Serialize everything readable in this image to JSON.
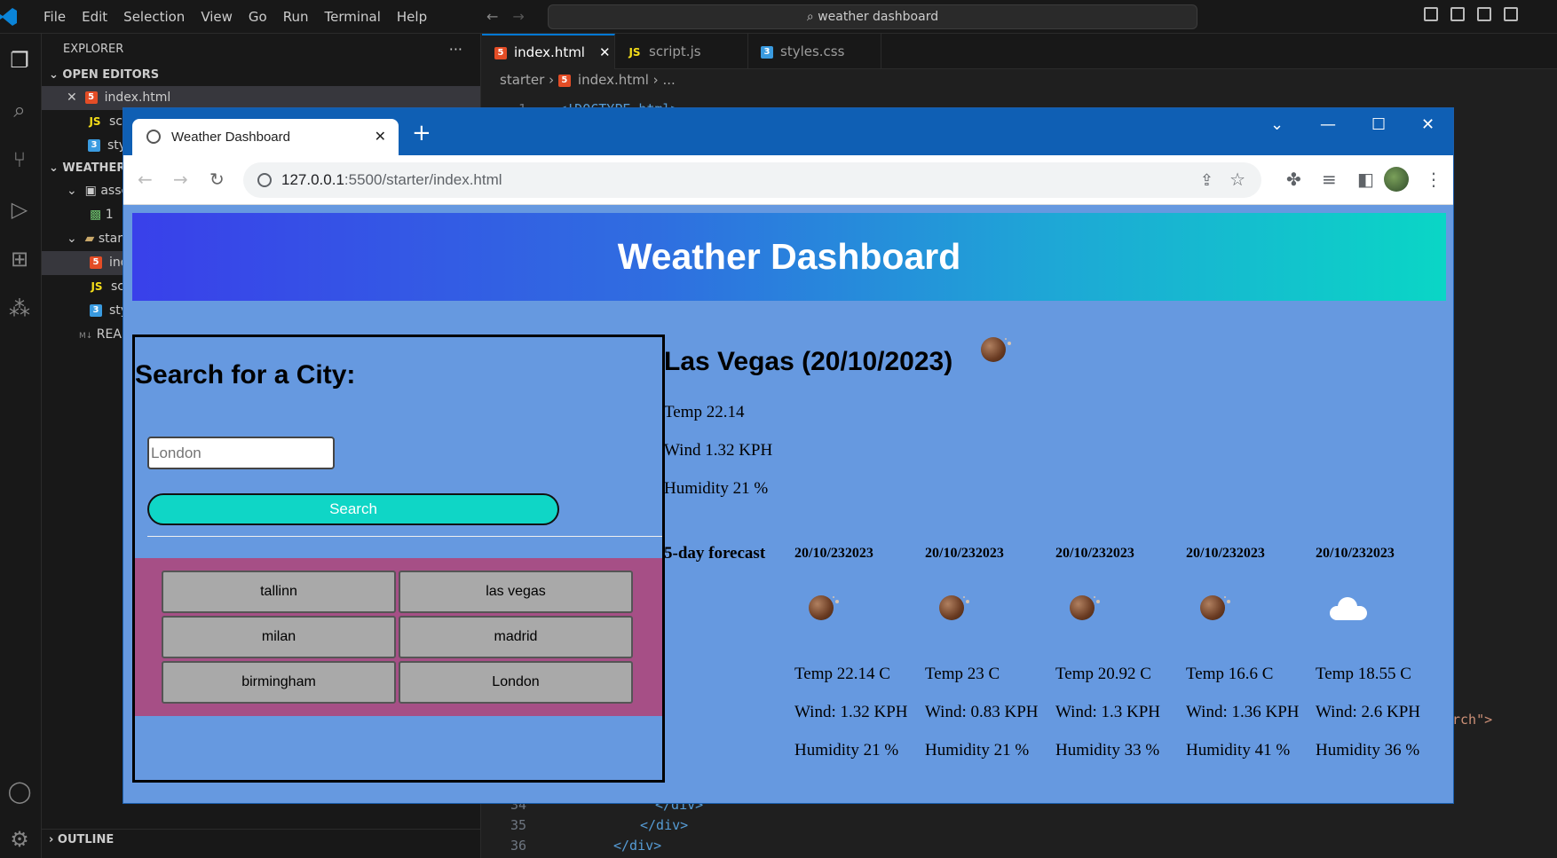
{
  "vscode": {
    "menu": [
      "File",
      "Edit",
      "Selection",
      "View",
      "Go",
      "Run",
      "Terminal",
      "Help"
    ],
    "command_search": "weather dashboard",
    "sidebar": {
      "title": "EXPLORER",
      "open_editors_label": "OPEN EDITORS",
      "project_label": "WEATHER",
      "readme_label": "REA",
      "outline_label": "OUTLINE",
      "open_editor_items": [
        "index.html",
        "script.js",
        "styles.css"
      ],
      "tree_items": [
        "assets",
        "1",
        "starter",
        "index.html",
        "script.js",
        "styles.css"
      ]
    },
    "tabs": [
      {
        "label": "index.html",
        "icon": "html5-icon",
        "active": true
      },
      {
        "label": "script.js",
        "icon": "js-icon",
        "active": false
      },
      {
        "label": "styles.css",
        "icon": "css3-icon",
        "active": false
      }
    ],
    "breadcrumb": {
      "folder": "starter",
      "file": "index.html",
      "rest": "..."
    },
    "code": {
      "line1_num": "1",
      "line1_text": "<!DOCTYPE html>",
      "right_fragment": "rch\">",
      "line34_num": "34",
      "line34_text": "</div>",
      "line35_num": "35",
      "line35_text": "</div>",
      "line36_num": "36",
      "line36_text": "</div>"
    }
  },
  "browser": {
    "tab_title": "Weather Dashboard",
    "url_host": "127.0.0.1",
    "url_path": ":5500/starter/index.html",
    "profile": "avatar"
  },
  "app": {
    "title": "Weather Dashboard",
    "search": {
      "heading": "Search for a City:",
      "input_placeholder": "London",
      "button_label": "Search"
    },
    "history": [
      "tallinn",
      "las vegas",
      "milan",
      "madrid",
      "birmingham",
      "London"
    ],
    "current": {
      "city_date": "Las Vegas (20/10/2023)",
      "icon": "night-moon-icon",
      "temp": "Temp 22.14",
      "wind": "Wind 1.32 KPH",
      "humidity": "Humidity 21 %"
    },
    "forecast_label": "5-day forecast",
    "forecast": [
      {
        "date": "20/10/232023",
        "icon": "night-moon-icon",
        "temp": "Temp 22.14 C",
        "wind": "Wind: 1.32 KPH",
        "humidity": "Humidity 21 %"
      },
      {
        "date": "20/10/232023",
        "icon": "night-moon-icon",
        "temp": "Temp 23 C",
        "wind": "Wind: 0.83 KPH",
        "humidity": "Humidity 21 %"
      },
      {
        "date": "20/10/232023",
        "icon": "night-moon-icon",
        "temp": "Temp 20.92 C",
        "wind": "Wind: 1.3 KPH",
        "humidity": "Humidity 33 %"
      },
      {
        "date": "20/10/232023",
        "icon": "night-moon-icon",
        "temp": "Temp 16.6 C",
        "wind": "Wind: 1.36 KPH",
        "humidity": "Humidity 41 %"
      },
      {
        "date": "20/10/232023",
        "icon": "cloud-icon",
        "temp": "Temp 18.55 C",
        "wind": "Wind: 2.6 KPH",
        "humidity": "Humidity 36 %"
      }
    ]
  },
  "colors": {
    "page_bg": "#6699e0",
    "hero_gradient_start": "#3940ea",
    "hero_gradient_end": "#0ad6c6",
    "search_button": "#0fd6c6",
    "history_bg": "#a64f86",
    "history_button": "#a9a9a9"
  }
}
